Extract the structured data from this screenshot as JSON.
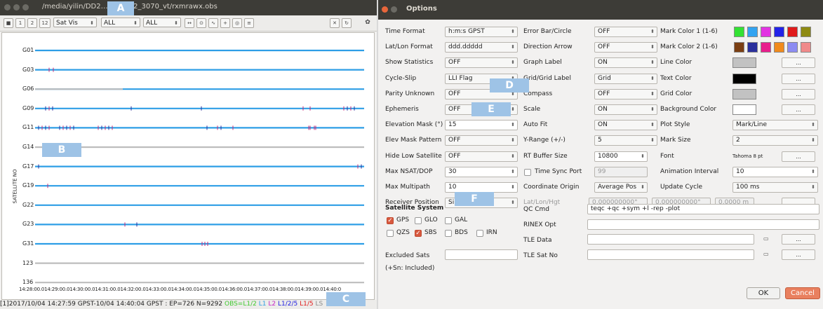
{
  "left_window": {
    "title": "/media/yilin/DD2…2017/D2_3070_vt/rxmrawx.obs",
    "toolbar": {
      "buttons_left": [
        "■",
        "1",
        "2",
        "12"
      ],
      "plot_type": "Sat Vis",
      "filter1": "ALL",
      "filter2": "ALL",
      "icons": [
        "fit-horizontal-icon",
        "center-icon",
        "graph-icon",
        "cross-icon",
        "ring-icon",
        "list-icon"
      ],
      "close_label": "✕",
      "reload_label": "↻",
      "settings_label": "✿"
    },
    "y_axis_label": "SATELLITE NO",
    "satellites": [
      "G01",
      "G03",
      "G06",
      "G09",
      "G11",
      "G14",
      "G17",
      "G19",
      "G22",
      "G23",
      "G31",
      "123",
      "136"
    ],
    "time_axis": "14:28:00.014:29:00.014:30:00.014:31:00.014:32:00.014:33:00.014:34:00.014:35:00.014:36:00.014:37:00.014:38:00.014:39:00.014:40:0",
    "status": {
      "prefix": "[1]2017/10/04 14:27:59 GPST-10/04 14:40:04 GPST : EP=726 N=9292 ",
      "obs": "OBS=L1/2",
      "l1": "L1",
      "l2": "L2",
      "l125": "L1/2/5",
      "l15": "L1/5",
      "ls": "LS"
    }
  },
  "badges": [
    "A",
    "B",
    "C",
    "D",
    "E",
    "F"
  ],
  "options": {
    "title": "Options",
    "col1": [
      {
        "label": "Time Format",
        "value": "h:m:s GPST"
      },
      {
        "label": "Lat/Lon Format",
        "value": "ddd.ddddd"
      },
      {
        "label": "Show Statistics",
        "value": "OFF"
      },
      {
        "label": "Cycle-Slip",
        "value": "LLI Flag"
      },
      {
        "label": "Parity Unknown",
        "value": "OFF"
      },
      {
        "label": "Ephemeris",
        "value": "OFF"
      },
      {
        "label": "Elevation Mask (°)",
        "value": "15"
      },
      {
        "label": "Elev Mask Pattern",
        "value": "OFF"
      },
      {
        "label": "Hide Low Satellite",
        "value": "OFF"
      },
      {
        "label": "Max NSAT/DOP",
        "value": "30"
      },
      {
        "label": "Max Multipath",
        "value": "10"
      },
      {
        "label": "Receiver Position",
        "value": "Single"
      }
    ],
    "col2": [
      {
        "label": "Error Bar/Circle",
        "value": "OFF"
      },
      {
        "label": "Direction Arrow",
        "value": "OFF"
      },
      {
        "label": "Graph Label",
        "value": "ON"
      },
      {
        "label": "Grid/Grid Label",
        "value": "Grid"
      },
      {
        "label": "Compass",
        "value": "OFF"
      },
      {
        "label": "Scale",
        "value": "ON"
      },
      {
        "label": "Auto Fit",
        "value": "ON"
      },
      {
        "label": "Y-Range (+/-)",
        "value": "5"
      },
      {
        "label": "RT Buffer Size",
        "value": "10800"
      },
      {
        "label": "Time Sync Port",
        "value": "99"
      },
      {
        "label": "Coordinate Origin",
        "value": "Average Pos"
      },
      {
        "label": "Lat/Lon/Hgt",
        "lat": "0,000000000°",
        "lon": "0,000000000°",
        "hgt": "0,0000 m"
      }
    ],
    "col3": [
      {
        "label": "Mark Color 1 (1-6)"
      },
      {
        "label": "Mark Color 2 (1-6)"
      },
      {
        "label": "Line Color"
      },
      {
        "label": "Text Color"
      },
      {
        "label": "Grid Color"
      },
      {
        "label": "Background Color"
      },
      {
        "label": "Plot Style",
        "value": "Mark/Line"
      },
      {
        "label": "Mark Size",
        "value": "2"
      },
      {
        "label": "Font",
        "value": "Tahoma 8 pt"
      },
      {
        "label": "Animation Interval",
        "value": "10"
      },
      {
        "label": "Update Cycle",
        "value": "100 ms"
      }
    ],
    "mark_colors_1": [
      "#33e133",
      "#33a3f0",
      "#e233e2",
      "#2222e8",
      "#e01b1b",
      "#8e8a12"
    ],
    "mark_colors_2": [
      "#7a3e12",
      "#2a2f9c",
      "#e81e8c",
      "#f08a1c",
      "#8c8cf2",
      "#f08a8a"
    ],
    "line_color": "#c2c2c2",
    "text_color": "#000000",
    "grid_color": "#c2c2c2",
    "background_color": "#ffffff",
    "ellipsis": "...",
    "satellite_system_title": "Satellite System",
    "systems": [
      {
        "name": "GPS",
        "checked": true
      },
      {
        "name": "GLO",
        "checked": false
      },
      {
        "name": "GAL",
        "checked": false
      },
      {
        "name": "QZS",
        "checked": false
      },
      {
        "name": "SBS",
        "checked": true
      },
      {
        "name": "BDS",
        "checked": false
      },
      {
        "name": "IRN",
        "checked": false
      }
    ],
    "qc_cmd_label": "QC Cmd",
    "qc_cmd_value": "teqc +qc +sym +l -rep -plot",
    "rinex_opt_label": "RINEX Opt",
    "tle_data_label": "TLE Data",
    "tle_satno_label": "TLE Sat No",
    "excluded_sats_label": "Excluded Sats",
    "included_note": "(+Sn: Included)",
    "ok_label": "OK",
    "cancel_label": "Cancel"
  }
}
